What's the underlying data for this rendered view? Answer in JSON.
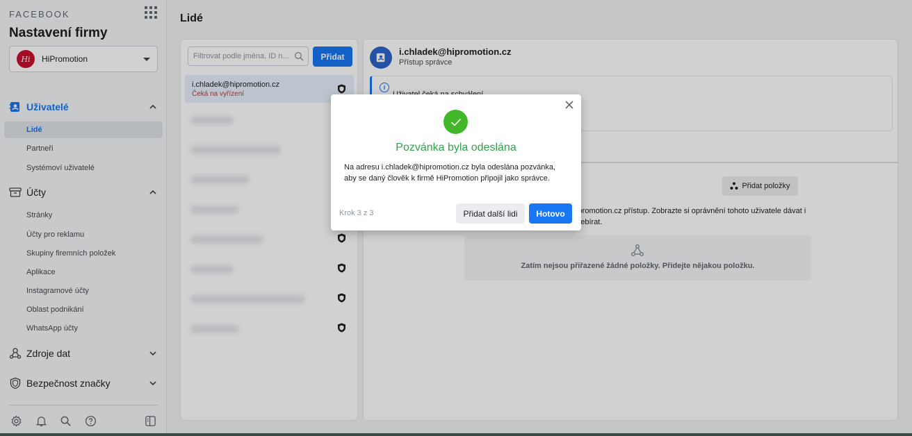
{
  "sidebar": {
    "brand": "FACEBOOK",
    "title": "Nastavení firmy",
    "business": {
      "name": "HiPromotion",
      "avatar_text": "Hi"
    },
    "sections": {
      "users": {
        "label": "Uživatelé",
        "items": [
          "Lidé",
          "Partneři",
          "Systémoví uživatelé"
        ]
      },
      "accounts": {
        "label": "Účty",
        "items": [
          "Stránky",
          "Účty pro reklamu",
          "Skupiny firemních položek",
          "Aplikace",
          "Instagramové účty",
          "Oblast podnikání",
          "WhatsApp účty"
        ]
      },
      "data_sources": {
        "label": "Zdroje dat"
      },
      "brand_safety": {
        "label": "Bezpečnost značky"
      }
    }
  },
  "main": {
    "title": "Lidé",
    "filter_placeholder": "Filtrovat podle jména, ID n...",
    "add_label": "Přidat",
    "selected_person": {
      "email": "i.chladek@hipromotion.cz",
      "status": "Čeká na vyřízení"
    }
  },
  "detail": {
    "email": "i.chladek@hipromotion.cz",
    "role": "Přístup správce",
    "notice": "Uživatel čeká na schválení",
    "add_items_label": "Přidat položky",
    "access_text": "hipromotion.cz přístup. Zobrazte si oprávnění tohoto uživatele dávat i odebírat.",
    "empty_text": "Zatím nejsou přiřazené žádné položky. Přidejte nějakou položku."
  },
  "modal": {
    "title": "Pozvánka byla odeslána",
    "body": "Na adresu i.chladek@hipromotion.cz byla odeslána pozvánka, aby se daný člověk k firmě HiPromotion připojil jako správce.",
    "step": "Krok 3 z 3",
    "add_more_label": "Přidat další lidi",
    "done_label": "Hotovo"
  },
  "colors": {
    "accent": "#1877f2",
    "success": "#42b72a",
    "pending": "#c0392b"
  }
}
